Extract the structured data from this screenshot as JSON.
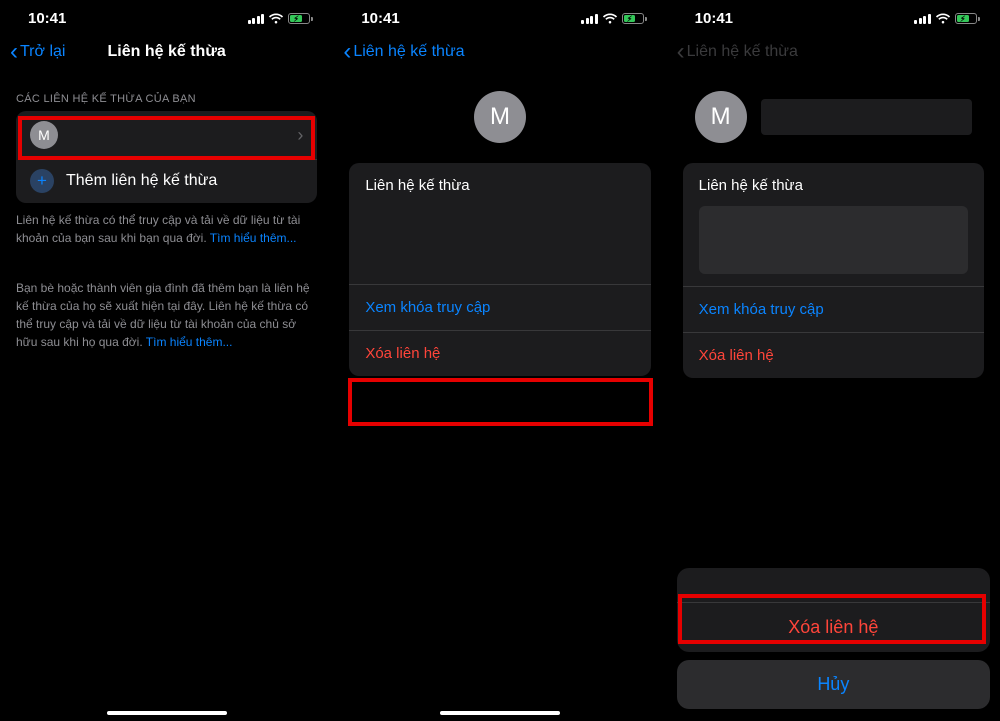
{
  "status": {
    "time": "10:41"
  },
  "screen1": {
    "back_label": "Trở lại",
    "title": "Liên hệ kế thừa",
    "section_header": "CÁC LIÊN HỆ KẾ THỪA CỦA BẠN",
    "contact_initial": "M",
    "add_label": "Thêm liên hệ kế thừa",
    "footer1_a": "Liên hệ kế thừa có thể truy cập và tải về dữ liệu từ tài khoản của bạn sau khi bạn qua đời. ",
    "footer1_link": "Tìm hiểu thêm...",
    "footer2_a": "Bạn bè hoặc thành viên gia đình đã thêm bạn là liên hệ kế thừa của họ sẽ xuất hiện tại đây. Liên hệ kế thừa có thể truy cập và tải về dữ liệu từ tài khoản của chủ sở hữu sau khi họ qua đời. ",
    "footer2_link": "Tìm hiểu thêm..."
  },
  "screen2": {
    "back_label": "Liên hệ kế thừa",
    "contact_initial": "M",
    "card_title": "Liên hệ kế thừa",
    "view_key": "Xem khóa truy cập",
    "delete": "Xóa liên hệ"
  },
  "screen3": {
    "back_label": "Liên hệ kế thừa",
    "contact_initial": "M",
    "card_title": "Liên hệ kế thừa",
    "view_key": "Xem khóa truy cập",
    "delete": "Xóa liên hệ",
    "sheet_delete": "Xóa liên hệ",
    "sheet_cancel": "Hủy"
  }
}
